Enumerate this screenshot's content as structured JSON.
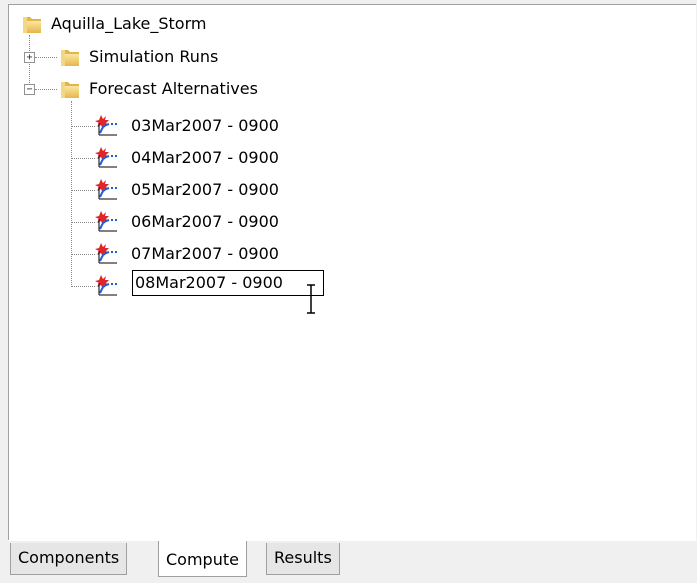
{
  "tree": {
    "root_label": "Aquilla_Lake_Storm",
    "children": [
      {
        "label": "Simulation Runs",
        "expander": "+"
      },
      {
        "label": "Forecast Alternatives",
        "expander": "−"
      }
    ],
    "forecast_items": [
      "03Mar2007 - 0900",
      "04Mar2007 - 0900",
      "05Mar2007 - 0900",
      "06Mar2007 - 0900",
      "07Mar2007 - 0900"
    ],
    "editing_item": "08Mar2007 - 0900"
  },
  "tabs": [
    {
      "label": "Components"
    },
    {
      "label": "Compute"
    },
    {
      "label": "Results"
    }
  ],
  "active_tab": "Compute",
  "icons": {
    "folder": "folder-icon",
    "forecast": "forecast-alternative-icon"
  }
}
